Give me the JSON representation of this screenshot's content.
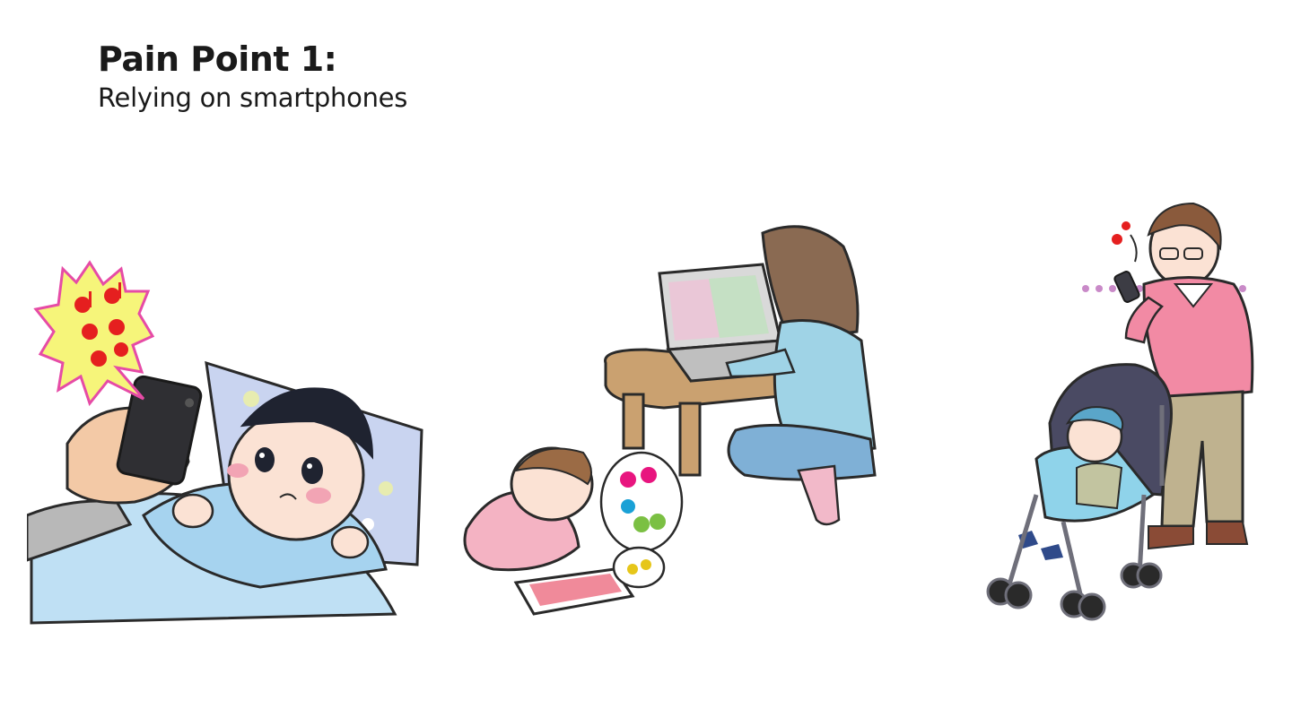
{
  "slide": {
    "title": "Pain Point 1:",
    "subtitle": "Relying on smartphones"
  },
  "illustrations": [
    {
      "name": "baby-in-bed-with-phone-scene",
      "description_icon": "baby-phone-illustration"
    },
    {
      "name": "mother-laptop-child-tablet-scene",
      "description_icon": "mother-laptop-illustration"
    },
    {
      "name": "father-phone-stroller-scene",
      "description_icon": "father-stroller-illustration"
    }
  ]
}
